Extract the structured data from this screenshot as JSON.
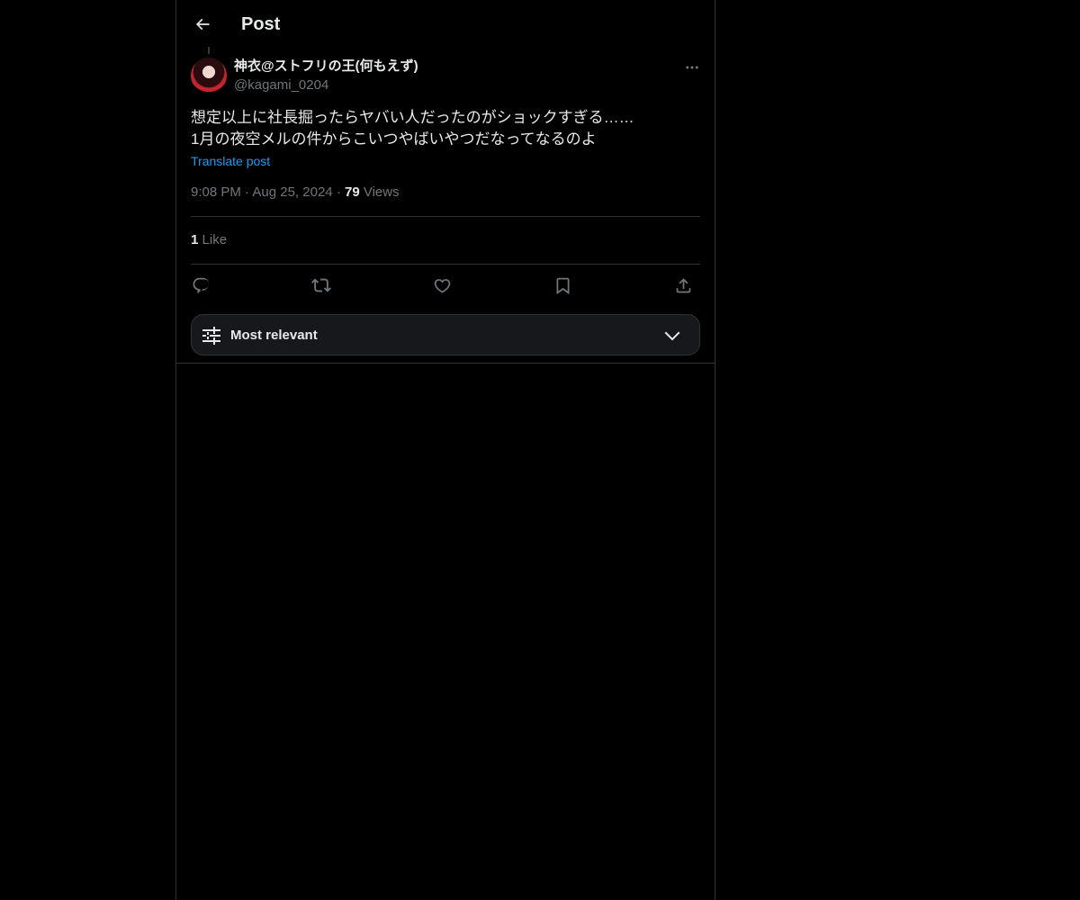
{
  "header": {
    "title": "Post",
    "back_icon": "arrow-left-icon"
  },
  "post": {
    "author_name": "神衣@ストフリの王(何もえず)",
    "author_handle": "@kagami_0204",
    "text_line1": "想定以上に社長掘ったらヤバい人だったのがショックすぎる……",
    "text_line2": "1月の夜空メルの件からこいつやばいやつだなってなるのよ",
    "translate_label": "Translate post",
    "time": "9:08 PM",
    "date": "Aug 25, 2024",
    "separator": "·",
    "views_count": "79",
    "views_label": "Views",
    "likes_count": "1",
    "likes_label": "Like"
  },
  "actions": {
    "reply_icon": "reply-icon",
    "repost_icon": "repost-icon",
    "like_icon": "heart-icon",
    "bookmark_icon": "bookmark-icon",
    "share_icon": "share-icon"
  },
  "sort": {
    "label": "Most relevant",
    "icon": "sliders-icon",
    "chevron": "chevron-down-icon"
  },
  "colors": {
    "background": "#000000",
    "text": "#e7e9ea",
    "muted": "#71767b",
    "link": "#1d9bf0",
    "border": "#2f3336"
  }
}
